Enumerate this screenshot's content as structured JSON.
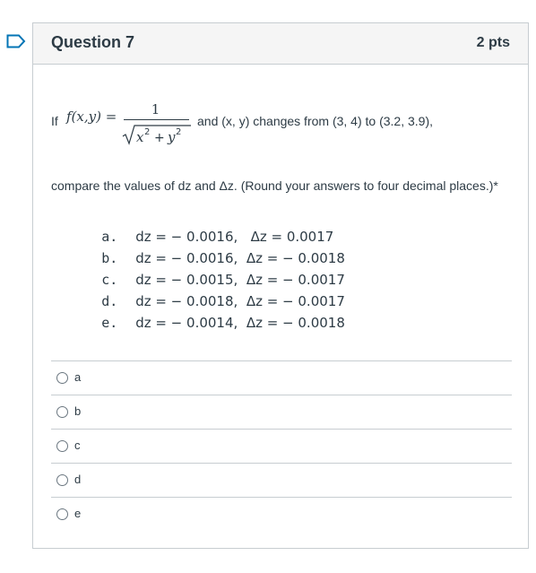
{
  "question": {
    "title": "Question 7",
    "points": "2 pts",
    "if_text": "If",
    "function_text": "f(x,y) =",
    "numerator": "1",
    "after_formula": "and (x, y) changes from (3, 4) to (3.2, 3.9),",
    "prompt": "compare the values of dz and Δz. (Round your answers to four decimal places.)*"
  },
  "choices": [
    {
      "letter": "a.",
      "text": "dz = − 0.0016,   Δz = 0.0017"
    },
    {
      "letter": "b.",
      "text": "dz = − 0.0016,  Δz = − 0.0018"
    },
    {
      "letter": "c.",
      "text": "dz = − 0.0015,  Δz = − 0.0017"
    },
    {
      "letter": "d.",
      "text": "dz = − 0.0018,  Δz = − 0.0017"
    },
    {
      "letter": "e.",
      "text": "dz = − 0.0014,  Δz = − 0.0018"
    }
  ],
  "answers": [
    {
      "label": "a"
    },
    {
      "label": "b"
    },
    {
      "label": "c"
    },
    {
      "label": "d"
    },
    {
      "label": "e"
    }
  ],
  "colors": {
    "border": "#c7cdd1",
    "header_bg": "#f5f5f5",
    "text": "#2d3b45",
    "flag": "#0374b5"
  },
  "icons": {
    "flag": "flag-outline-icon"
  }
}
